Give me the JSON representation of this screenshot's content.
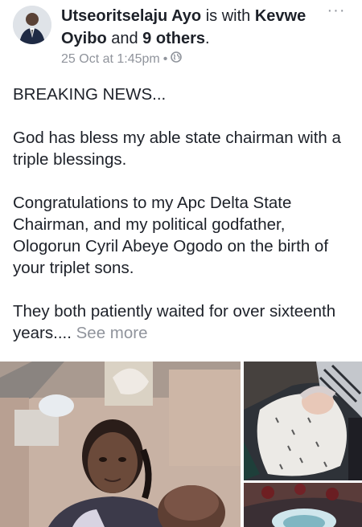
{
  "post": {
    "author": "Utseoritselaju Ayo",
    "with_word": "is with",
    "tagged": "Kevwe Oyibo",
    "and_word": "and",
    "others": "9 others",
    "period": ".",
    "date": "25 Oct at 1:45pm",
    "separator": "•",
    "audience_icon": "globe-icon",
    "more_icon": "more-options-icon",
    "more_glyph": "···",
    "paragraphs": [
      "BREAKING NEWS...",
      "God has bless my able state chairman with a triple blessings.",
      "Congratulations to my Apc Delta State Chairman, and my political godfather, Ologorun Cyril Abeye Ogodo on the birth of your triplet sons."
    ],
    "last_paragraph": "They both patiently waited for over sixteenth years....",
    "see_more": "See more"
  },
  "photos": [
    {
      "icon": "photo-woman-with-baby"
    },
    {
      "icon": "photo-newborn-baby"
    },
    {
      "icon": "photo-newborn-baby-2"
    }
  ],
  "colors": {
    "text": "#1d2129",
    "meta": "#90949c"
  }
}
